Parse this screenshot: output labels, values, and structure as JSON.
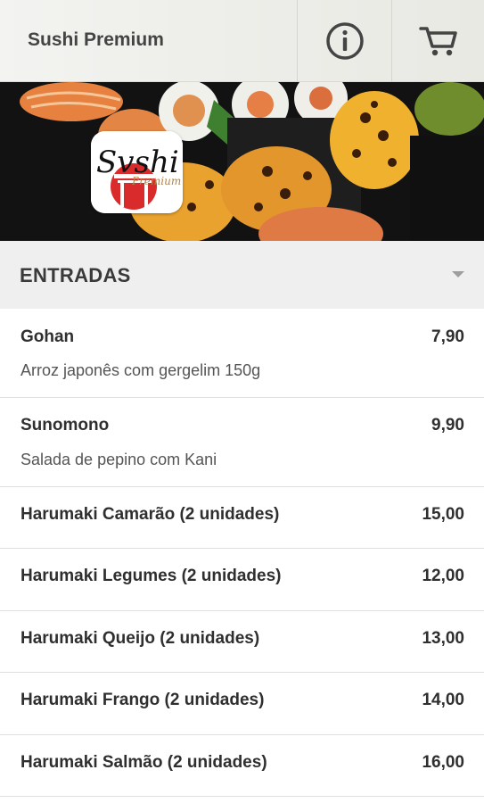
{
  "header": {
    "title": "Sushi Premium",
    "info_icon": "info-icon",
    "cart_icon": "cart-icon"
  },
  "banner": {
    "logo_text": "Sushi",
    "logo_subtext": "Premium"
  },
  "section": {
    "title": "ENTRADAS",
    "toggle_icon": "chevron-down-icon"
  },
  "items": [
    {
      "name": "Gohan",
      "price": "7,90",
      "description": "Arroz japonês com gergelim 150g"
    },
    {
      "name": "Sunomono",
      "price": "9,90",
      "description": "Salada de pepino com Kani"
    },
    {
      "name": "Harumaki Camarão (2 unidades)",
      "price": "15,00"
    },
    {
      "name": "Harumaki Legumes (2 unidades)",
      "price": "12,00"
    },
    {
      "name": "Harumaki Queijo (2 unidades)",
      "price": "13,00"
    },
    {
      "name": "Harumaki Frango (2 unidades)",
      "price": "14,00"
    },
    {
      "name": "Harumaki Salmão (2 unidades)",
      "price": "16,00"
    }
  ],
  "colors": {
    "accent": "#d92b2b",
    "section_bg": "#efefef"
  }
}
